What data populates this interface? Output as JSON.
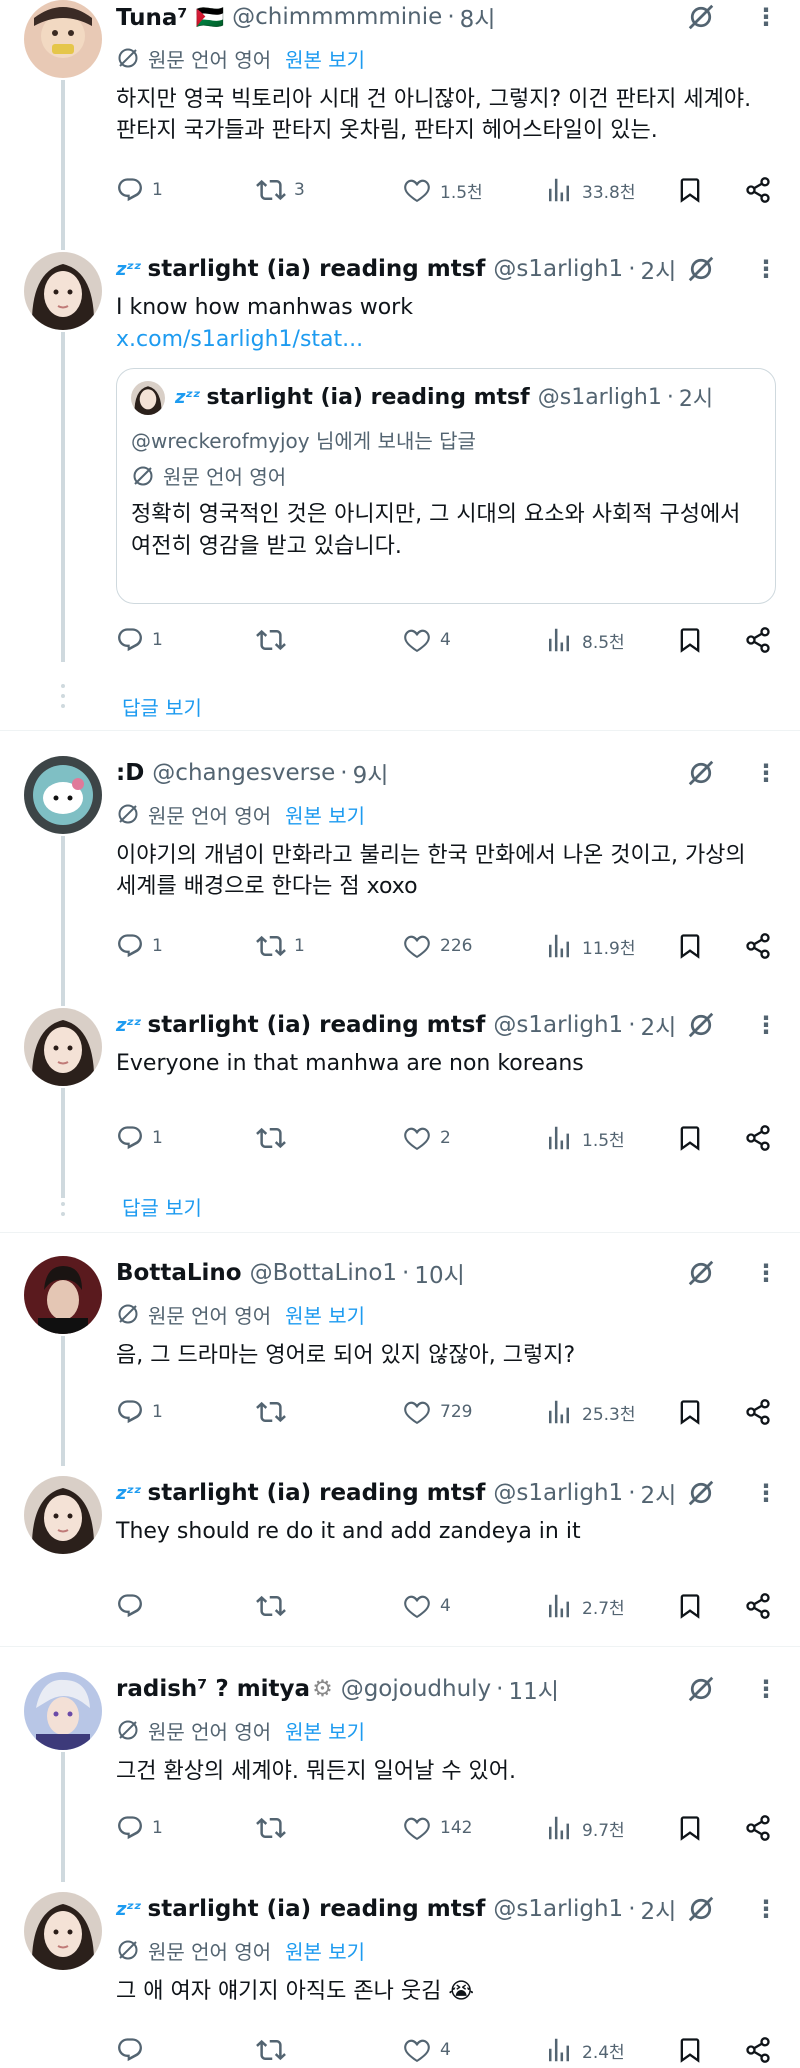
{
  "common": {
    "translated_label": "원문 언어 영어",
    "show_original": "원본 보기",
    "show_replies": "답글 보기",
    "dot": "·"
  },
  "tweets": [
    {
      "name": "Tuna⁷ 🇵🇸",
      "handle": "@chimmmmminie",
      "time": "8시",
      "text": "하지만 영국 빅토리아 시대 건 아니잖아, 그렇지? 이건 판타지 세계야.\n판타지 국가들과 판타지 옷차림, 판타지 헤어스타일이 있는.",
      "replies": "1",
      "retweets": "3",
      "likes": "1.5천",
      "views": "33.8천"
    },
    {
      "name": "starlight (ia) reading mtsf",
      "handle": "@s1arligh1",
      "time": "2시",
      "text": "I know how manhwas work",
      "link": "x.com/s1arligh1/stat...",
      "quote": {
        "name": "starlight (ia) reading mtsf",
        "handle": "@s1arligh1",
        "time": "2시",
        "reply_to": "@wreckerofmyjoy 님에게 보내는 답글",
        "translated_label": "원문 언어 영어",
        "text": "정확히 영국적인 것은 아니지만, 그 시대의 요소와 사회적 구성에서\n여전히 영감을 받고 있습니다."
      },
      "replies": "1",
      "retweets": "",
      "likes": "4",
      "views": "8.5천"
    },
    {
      "name": ":D",
      "handle": "@changesverse",
      "time": "9시",
      "text": "이야기의 개념이 만화라고 불리는 한국 만화에서 나온 것이고, 가상의\n세계를 배경으로 한다는 점 xoxo",
      "replies": "1",
      "retweets": "1",
      "likes": "226",
      "views": "11.9천"
    },
    {
      "name": "starlight (ia) reading mtsf",
      "handle": "@s1arligh1",
      "time": "2시",
      "text": "Everyone in that manhwa are non koreans",
      "replies": "1",
      "retweets": "",
      "likes": "2",
      "views": "1.5천"
    },
    {
      "name": "BottaLino",
      "handle": "@BottaLino1",
      "time": "10시",
      "text": "음, 그 드라마는 영어로 되어 있지 않잖아, 그렇지?",
      "replies": "1",
      "retweets": "",
      "likes": "729",
      "views": "25.3천"
    },
    {
      "name": "starlight (ia) reading mtsf",
      "handle": "@s1arligh1",
      "time": "2시",
      "text": "They should re do it and add zandeya in it",
      "replies": "",
      "retweets": "",
      "likes": "4",
      "views": "2.7천"
    },
    {
      "name": "radish⁷ ? mitya",
      "handle": "@gojoudhuly",
      "time": "11시",
      "text": "그건 환상의 세계야. 뭐든지 일어날 수 있어.",
      "replies": "1",
      "retweets": "",
      "likes": "142",
      "views": "9.7천"
    },
    {
      "name": "starlight (ia) reading mtsf",
      "handle": "@s1arligh1",
      "time": "2시",
      "text": "그 애 여자 얘기지 아직도 존나 웃김 😭",
      "replies": "",
      "retweets": "",
      "likes": "4",
      "views": "2.4천"
    }
  ]
}
